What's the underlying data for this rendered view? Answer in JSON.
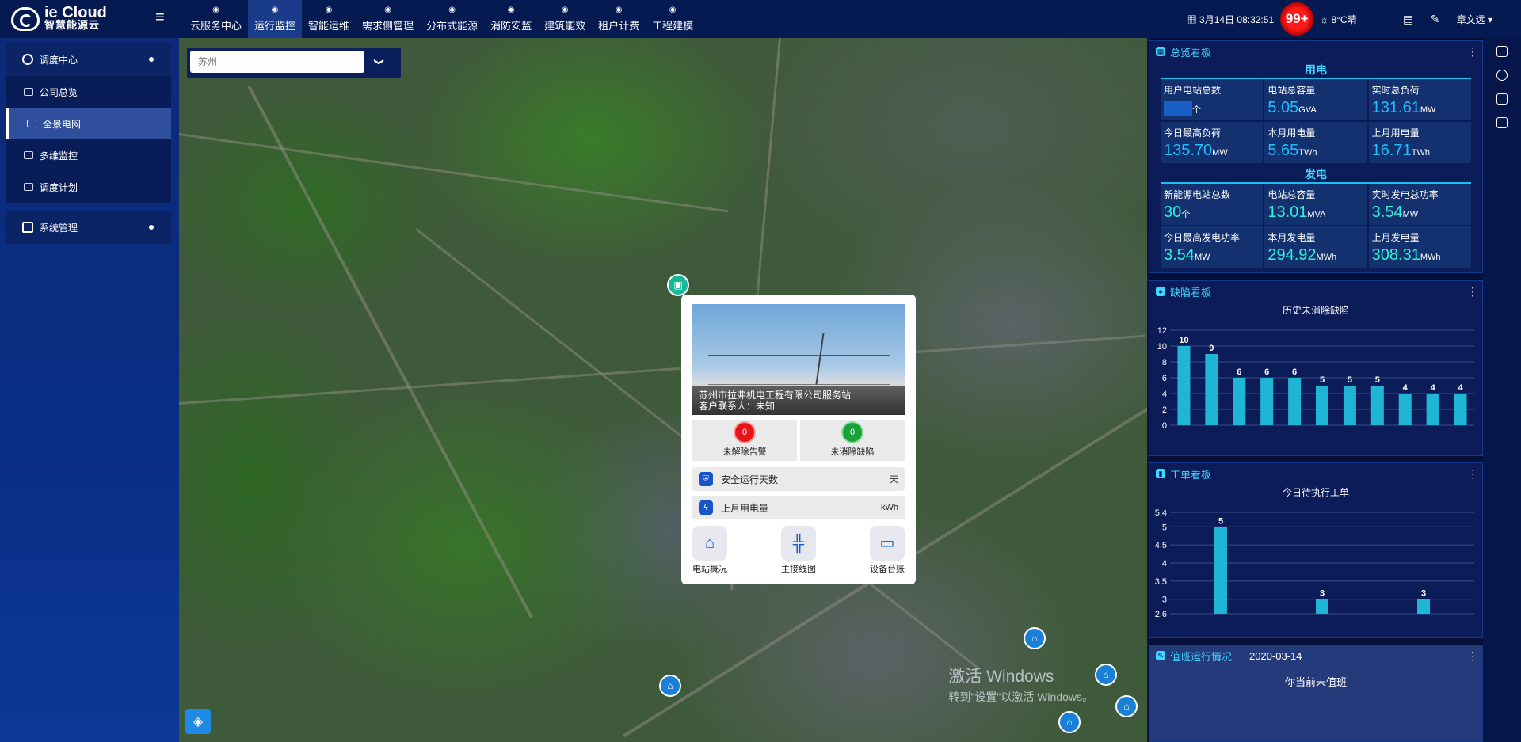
{
  "app": {
    "logo_line1": "ie Cloud",
    "logo_line2": "智慧能源云"
  },
  "topnav": [
    {
      "label": "云服务中心",
      "icon": "cloud-service-icon"
    },
    {
      "label": "运行监控",
      "icon": "monitor-icon"
    },
    {
      "label": "智能运维",
      "icon": "maintenance-icon"
    },
    {
      "label": "需求侧管理",
      "icon": "demand-icon"
    },
    {
      "label": "分布式能源",
      "icon": "distributed-energy-icon"
    },
    {
      "label": "消防安监",
      "icon": "fire-safety-icon"
    },
    {
      "label": "建筑能效",
      "icon": "building-icon"
    },
    {
      "label": "租户计费",
      "icon": "billing-icon"
    },
    {
      "label": "工程建模",
      "icon": "modeling-icon"
    }
  ],
  "topbar": {
    "datetime": "3月14日 08:32:51",
    "alarm_badge": "99+",
    "weather": "8°C晴",
    "user": "章文远"
  },
  "sidebar": {
    "group1_title": "调度中心",
    "items": [
      "公司总览",
      "全景电网",
      "多维监控",
      "调度计划"
    ],
    "active_index": 1,
    "group2_title": "系统管理"
  },
  "map": {
    "search_placeholder": "苏州",
    "popup": {
      "station_name": "苏州市拉弗机电工程有限公司服务站",
      "contact_label": "客户联系人：未知",
      "alarm_count": "0",
      "alarm_label": "未解除告警",
      "defect_count": "0",
      "defect_label": "未消除缺陷",
      "row1_label": "安全运行天数",
      "row1_unit": "天",
      "row2_label": "上月用电量",
      "row2_unit": "kWh",
      "actions": [
        "电站概况",
        "主接线图",
        "设备台账"
      ]
    },
    "watermark_line1": "激活 Windows",
    "watermark_line2": "转到\"设置\"以激活 Windows。"
  },
  "overview": {
    "title": "总览看板",
    "consumption_title": "用电",
    "consumption": [
      {
        "label": "用户电站总数",
        "value": "",
        "unit": "个"
      },
      {
        "label": "电站总容量",
        "value": "5.05",
        "unit": "GVA"
      },
      {
        "label": "实时总负荷",
        "value": "131.61",
        "unit": "MW"
      },
      {
        "label": "今日最高负荷",
        "value": "135.70",
        "unit": "MW"
      },
      {
        "label": "本月用电量",
        "value": "5.65",
        "unit": "TWh"
      },
      {
        "label": "上月用电量",
        "value": "16.71",
        "unit": "TWh"
      }
    ],
    "generation_title": "发电",
    "generation": [
      {
        "label": "新能源电站总数",
        "value": "30",
        "unit": "个"
      },
      {
        "label": "电站总容量",
        "value": "13.01",
        "unit": "MVA"
      },
      {
        "label": "实时发电总功率",
        "value": "3.54",
        "unit": "MW"
      },
      {
        "label": "今日最高发电功率",
        "value": "3.54",
        "unit": "MW"
      },
      {
        "label": "本月发电量",
        "value": "294.92",
        "unit": "MWh"
      },
      {
        "label": "上月发电量",
        "value": "308.31",
        "unit": "MWh"
      }
    ]
  },
  "defect_panel": {
    "title": "缺陷看板"
  },
  "workorder_panel": {
    "title": "工单看板"
  },
  "duty_panel": {
    "title": "值班运行情况",
    "date": "2020-03-14",
    "message": "你当前未值班"
  },
  "chart_data": [
    {
      "type": "bar",
      "title": "历史未消除缺陷",
      "categories": [
        "",
        "",
        "",
        "",
        "",
        "",
        "",
        "",
        "",
        "",
        ""
      ],
      "values": [
        10,
        9,
        6,
        6,
        6,
        5,
        5,
        5,
        4,
        4,
        4
      ],
      "ylim": [
        0,
        12
      ],
      "yticks": [
        0,
        2,
        4,
        6,
        8,
        10,
        12
      ],
      "grid": true,
      "color": "#1fb6d6"
    },
    {
      "type": "bar",
      "title": "今日待执行工单",
      "categories": [
        "",
        "",
        ""
      ],
      "values": [
        5,
        3,
        3
      ],
      "ylim": [
        2.6,
        5.4
      ],
      "yticks": [
        2.6,
        3,
        3.5,
        4,
        4.5,
        5,
        5.4
      ],
      "grid": true,
      "color": "#1fb6d6"
    }
  ]
}
